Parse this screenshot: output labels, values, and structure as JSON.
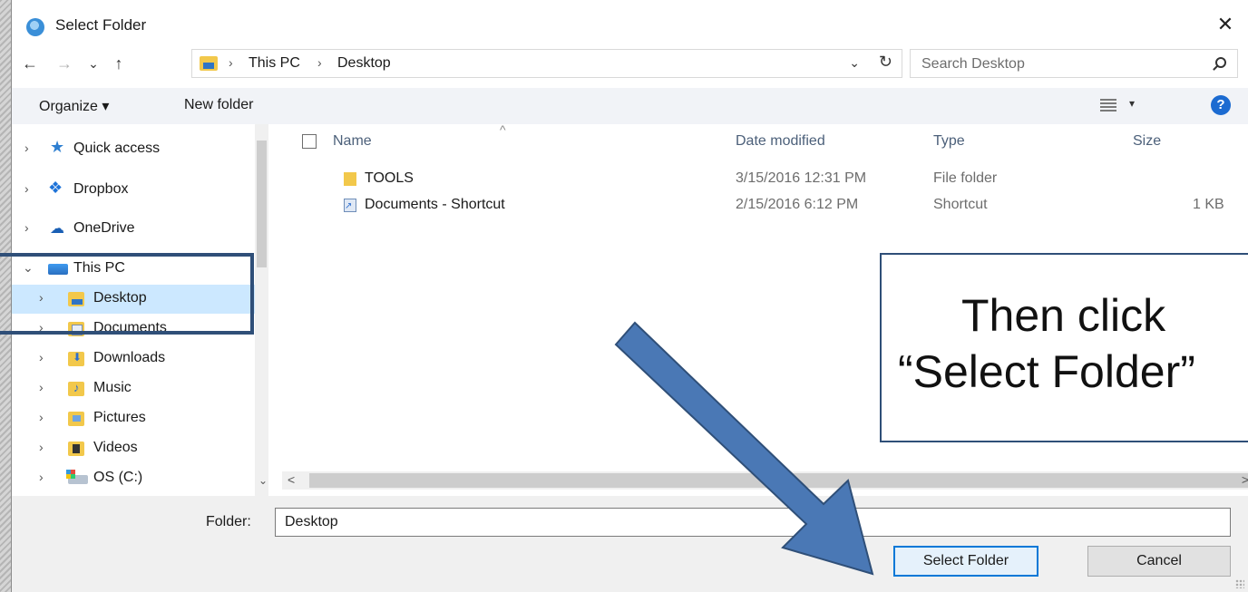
{
  "window": {
    "title": "Select Folder",
    "close_glyph": "✕"
  },
  "nav": {
    "back_glyph": "←",
    "forward_glyph": "→",
    "recent_glyph": "⌄",
    "up_glyph": "↑",
    "breadcrumb": [
      "This PC",
      "Desktop"
    ],
    "crumb_sep": "›",
    "dropdown_glyph": "⌄",
    "refresh_glyph": "↻",
    "search_placeholder": "Search Desktop"
  },
  "toolbar": {
    "organize_label": "Organize ▾",
    "new_folder_label": "New folder",
    "view_caret": "▾",
    "help_glyph": "?"
  },
  "sidebar": {
    "items": [
      {
        "label": "Quick access",
        "chevron": "›",
        "icon": "star-icon"
      },
      {
        "label": "Dropbox",
        "chevron": "›",
        "icon": "dropbox-icon"
      },
      {
        "label": "OneDrive",
        "chevron": "›",
        "icon": "onedrive-cloud-icon"
      },
      {
        "label": "This PC",
        "chevron": "⌄",
        "icon": "computer-icon"
      },
      {
        "label": "Desktop",
        "chevron": "›",
        "icon": "desktop-folder-icon",
        "selected": true
      },
      {
        "label": "Documents",
        "chevron": "›",
        "icon": "documents-folder-icon"
      },
      {
        "label": "Downloads",
        "chevron": "›",
        "icon": "downloads-folder-icon"
      },
      {
        "label": "Music",
        "chevron": "›",
        "icon": "music-folder-icon"
      },
      {
        "label": "Pictures",
        "chevron": "›",
        "icon": "pictures-folder-icon"
      },
      {
        "label": "Videos",
        "chevron": "›",
        "icon": "videos-folder-icon"
      },
      {
        "label": "OS (C:)",
        "chevron": "›",
        "icon": "drive-icon"
      }
    ],
    "scroll_down_glyph": "⌄"
  },
  "table": {
    "columns": [
      "Name",
      "Date modified",
      "Type",
      "Size"
    ],
    "sort_glyph": "^",
    "rows": [
      {
        "name": "TOOLS",
        "date": "3/15/2016 12:31 PM",
        "type": "File folder",
        "size": ""
      },
      {
        "name": "Documents - Shortcut",
        "date": "2/15/2016 6:12 PM",
        "type": "Shortcut",
        "size": "1 KB"
      }
    ],
    "hscroll_left": "<",
    "hscroll_right": ">"
  },
  "footer": {
    "folder_label": "Folder:",
    "folder_value": "Desktop",
    "select_label": "Select Folder",
    "cancel_label": "Cancel"
  },
  "annotation": {
    "callout_line1": "Then click",
    "callout_line2": "“Select Folder”",
    "arrow_color": "#4a78b5",
    "box_color": "#2f4f78"
  }
}
